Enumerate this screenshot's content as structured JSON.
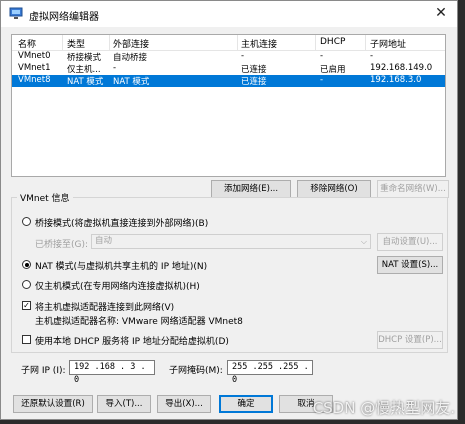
{
  "window": {
    "title": "虚拟网络编辑器",
    "close_glyph": "✕"
  },
  "list": {
    "columns": [
      "名称",
      "类型",
      "外部连接",
      "主机连接",
      "DHCP",
      "子网地址"
    ],
    "rows": [
      {
        "name": "VMnet0",
        "type": "桥接模式",
        "external": "自动桥接",
        "host": "-",
        "dhcp": "-",
        "subnet": "-"
      },
      {
        "name": "VMnet1",
        "type": "仅主机...",
        "external": "-",
        "host": "已连接",
        "dhcp": "已启用",
        "subnet": "192.168.149.0"
      },
      {
        "name": "VMnet8",
        "type": "NAT 模式",
        "external": "NAT 模式",
        "host": "已连接",
        "dhcp": "-",
        "subnet": "192.168.3.0"
      }
    ],
    "selected_index": 2
  },
  "list_buttons": {
    "add": "添加网络(E)...",
    "remove": "移除网络(O)",
    "rename": "重命名网络(W)..."
  },
  "info": {
    "group_label": "VMnet 信息",
    "bridge_radio": "桥接模式(将虚拟机直接连接到外部网络)(B)",
    "bridged_to_label": "已桥接至(G):",
    "bridged_to_value": "自动",
    "auto_settings": "自动设置(U)...",
    "nat_radio": "NAT 模式(与虚拟机共享主机的 IP 地址)(N)",
    "nat_settings": "NAT 设置(S)...",
    "hostonly_radio": "仅主机模式(在专用网络内连接虚拟机)(H)",
    "connect_adapter_check": "将主机虚拟适配器连接到此网络(V)",
    "adapter_name": "主机虚拟适配器名称: VMware 网络适配器 VMnet8",
    "dhcp_check": "使用本地 DHCP 服务将 IP 地址分配给虚拟机(D)",
    "dhcp_settings": "DHCP 设置(P)...",
    "subnet_ip_label": "子网 IP (I):",
    "subnet_ip_value": "192 .168 . 3  . 0",
    "subnet_mask_label": "子网掩码(M):",
    "subnet_mask_value": "255 .255 .255 . 0",
    "selected_mode": "nat",
    "connect_adapter_checked": true,
    "dhcp_checked": false
  },
  "footer": {
    "restore": "还原默认设置(R)",
    "import": "导入(T)...",
    "export": "导出(X)...",
    "ok": "确定",
    "cancel": "取消",
    "watermark": "CSDN @慢热型网友."
  }
}
